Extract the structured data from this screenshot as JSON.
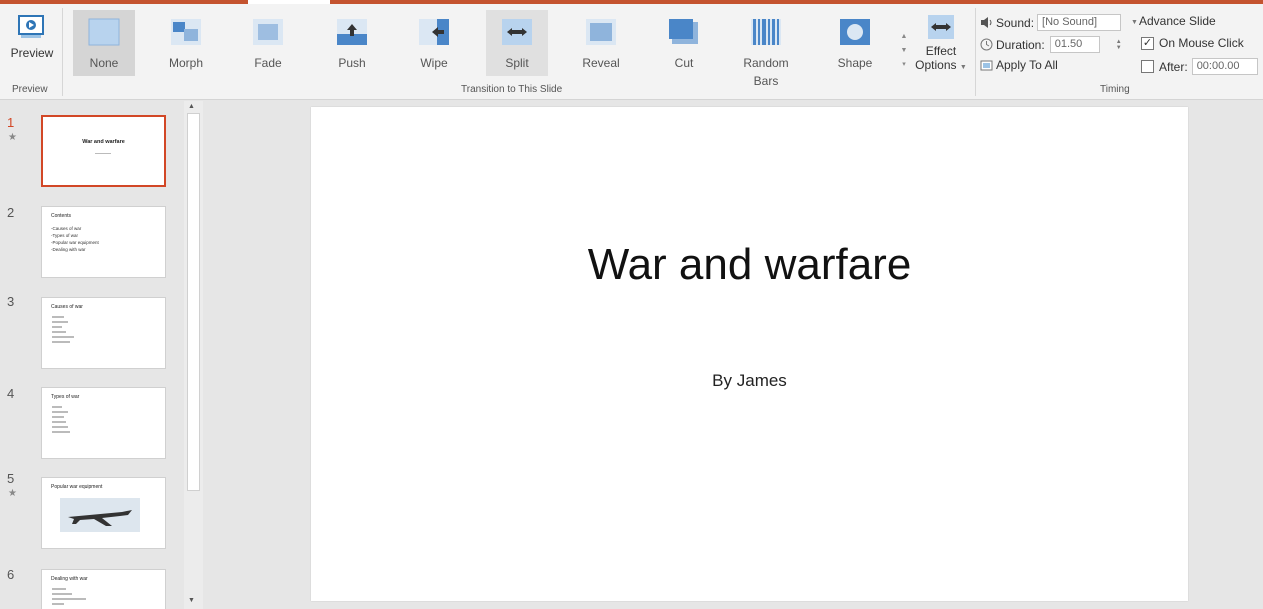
{
  "ribbon": {
    "preview": {
      "label": "Preview",
      "group_label": "Preview"
    },
    "transitions": {
      "group_label": "Transition to This Slide",
      "items": [
        {
          "label": "None",
          "icon": "none-transition-icon"
        },
        {
          "label": "Morph",
          "icon": "morph-transition-icon"
        },
        {
          "label": "Fade",
          "icon": "fade-transition-icon"
        },
        {
          "label": "Push",
          "icon": "push-transition-icon"
        },
        {
          "label": "Wipe",
          "icon": "wipe-transition-icon"
        },
        {
          "label": "Split",
          "icon": "split-transition-icon"
        },
        {
          "label": "Reveal",
          "icon": "reveal-transition-icon"
        },
        {
          "label": "Cut",
          "icon": "cut-transition-icon"
        },
        {
          "label": "Random Bars",
          "icon": "random-bars-transition-icon"
        },
        {
          "label": "Shape",
          "icon": "shape-transition-icon"
        }
      ],
      "selected": "None",
      "hovered": "Split"
    },
    "effect_options": {
      "line1": "Effect",
      "line2": "Options"
    },
    "timing": {
      "group_label": "Timing",
      "sound_label": "Sound:",
      "sound_value": "[No Sound]",
      "duration_label": "Duration:",
      "duration_value": "01.50",
      "apply_all_label": "Apply To All",
      "advance_label": "Advance Slide",
      "on_click_label": "On Mouse Click",
      "on_click_checked": true,
      "after_label": "After:",
      "after_value": "00:00.00",
      "after_checked": false
    }
  },
  "slides": [
    {
      "number": "1",
      "title": "War and warfare",
      "active": true,
      "has_star": true
    },
    {
      "number": "2",
      "title": "Contents",
      "lines": [
        "-Causes of war",
        "-Types of war",
        "-Popular war equipment",
        "-Dealing with war"
      ],
      "has_star": false
    },
    {
      "number": "3",
      "title": "Causes of war",
      "has_star": false
    },
    {
      "number": "4",
      "title": "Types of war",
      "has_star": false
    },
    {
      "number": "5",
      "title": "Popular war equipment",
      "has_star": true
    },
    {
      "number": "6",
      "title": "Dealing with war",
      "has_star": false
    }
  ],
  "main_slide": {
    "title": "War and warfare",
    "subtitle": "By James"
  },
  "colors": {
    "accent": "#c4532f",
    "selected_border": "#d24726",
    "icon_blue": "#4a86c8"
  }
}
